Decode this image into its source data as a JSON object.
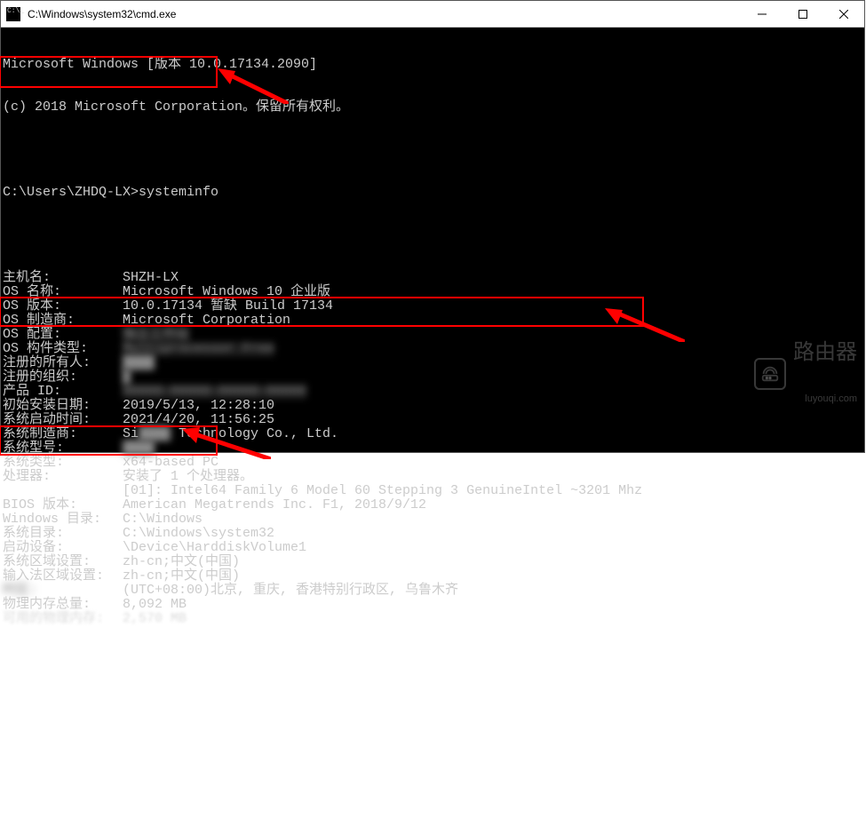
{
  "titlebar": {
    "title": "C:\\Windows\\system32\\cmd.exe"
  },
  "header": {
    "line1": "Microsoft Windows [版本 10.0.17134.2090]",
    "line2": "(c) 2018 Microsoft Corporation。保留所有权利。"
  },
  "prompt": {
    "path": "C:\\Users\\ZHDQ-LX>",
    "command": "systeminfo"
  },
  "systeminfo": {
    "rows": [
      {
        "label": "主机名:",
        "value": "SHZH-LX"
      },
      {
        "label": "OS 名称:",
        "value": "Microsoft Windows 10 企业版"
      },
      {
        "label": "OS 版本:",
        "value": "10.0.17134 暂缺 Build 17134"
      },
      {
        "label": "OS 制造商:",
        "value": "Microsoft Corporation"
      },
      {
        "label": "OS 配置:",
        "value": "",
        "blur": true,
        "blurtext": "独立工作站"
      },
      {
        "label": "OS 构件类型:",
        "value": "",
        "blur": true,
        "blurtext": "Multiprocessor Free"
      },
      {
        "label": "注册的所有人:",
        "value": "",
        "blur": true,
        "blurtext": "████"
      },
      {
        "label": "注册的组织:",
        "value": "",
        "blur": true,
        "blurtext": "█"
      },
      {
        "label": "产品 ID:",
        "value": "",
        "blur": true,
        "blurtext": "00000-00000-00000-00000"
      },
      {
        "label": "初始安装日期:",
        "value": "2019/5/13, 12:28:10",
        "blurvalue": true
      },
      {
        "label": "系统启动时间:",
        "value": "2021/4/20, 11:56:25"
      },
      {
        "label": "系统制造商:",
        "value": "Si       Technology Co., Ltd.",
        "partialblur": true
      },
      {
        "label": "系统型号:",
        "value": "",
        "blur": true,
        "blurtext": "████"
      },
      {
        "label": "系统类型:",
        "value": "x64-based PC"
      },
      {
        "label": "处理器:",
        "value": "安装了 1 个处理器。"
      },
      {
        "label": "",
        "value": "[01]: Intel64 Family 6 Model 60 Stepping 3 GenuineIntel ~3201 Mhz"
      },
      {
        "label": "BIOS 版本:",
        "value": "American Megatrends Inc. F1, 2018/9/12"
      },
      {
        "label": "Windows 目录:",
        "value": "C:\\Windows"
      },
      {
        "label": "系统目录:",
        "value": "C:\\Windows\\system32"
      },
      {
        "label": "启动设备:",
        "value": "\\Device\\HarddiskVolume1"
      },
      {
        "label": "系统区域设置:",
        "value": "zh-cn;中文(中国)"
      },
      {
        "label": "输入法区域设置:",
        "value": "zh-cn;中文(中国)"
      },
      {
        "label": "时区:",
        "value": "(UTC+08:00)北京, 重庆, 香港特别行政区, 乌鲁木齐",
        "labelblur": true
      },
      {
        "label": "物理内存总量:",
        "value": "8,092 MB"
      },
      {
        "label": "可用的物理内存:",
        "value": "2,570 MB",
        "lineblur": true
      }
    ]
  },
  "watermark": {
    "big": "路由器",
    "small": "luyouqi.com"
  }
}
